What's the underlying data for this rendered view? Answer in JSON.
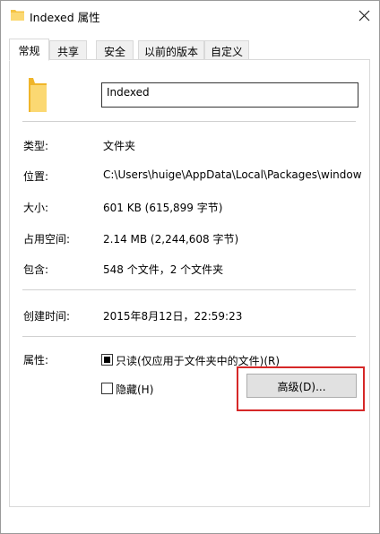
{
  "window": {
    "title": "Indexed 属性",
    "close_glyph": "✕"
  },
  "tabs": [
    {
      "label": "常规",
      "active": true
    },
    {
      "label": "共享",
      "active": false
    },
    {
      "label": "安全",
      "active": false
    },
    {
      "label": "以前的版本",
      "active": false
    },
    {
      "label": "自定义",
      "active": false
    }
  ],
  "general": {
    "folder_name": "Indexed",
    "rows": [
      {
        "label": "类型:",
        "value": "文件夹"
      },
      {
        "label": "位置:",
        "value": "C:\\Users\\huige\\AppData\\Local\\Packages\\window"
      },
      {
        "label": "大小:",
        "value": "601 KB (615,899 字节)"
      },
      {
        "label": "占用空间:",
        "value": "2.14 MB (2,244,608 字节)"
      },
      {
        "label": "包含:",
        "value": "548 个文件，2 个文件夹"
      }
    ],
    "created": {
      "label": "创建时间:",
      "value": "2015年8月12日，22:59:23"
    },
    "attributes": {
      "label": "属性:",
      "readonly": {
        "label": "只读(仅应用于文件夹中的文件)(R)",
        "checked": "indeterminate"
      },
      "hidden": {
        "label": "隐藏(H)",
        "checked": false
      },
      "advanced_button": "高级(D)..."
    }
  },
  "colors": {
    "folder_yellow": "#f5c342",
    "highlight_red": "#d62828",
    "tab_border": "#d9d9d9"
  },
  "icons": {
    "title": "folder-icon",
    "close": "close-icon",
    "folder_large": "folder-icon"
  }
}
